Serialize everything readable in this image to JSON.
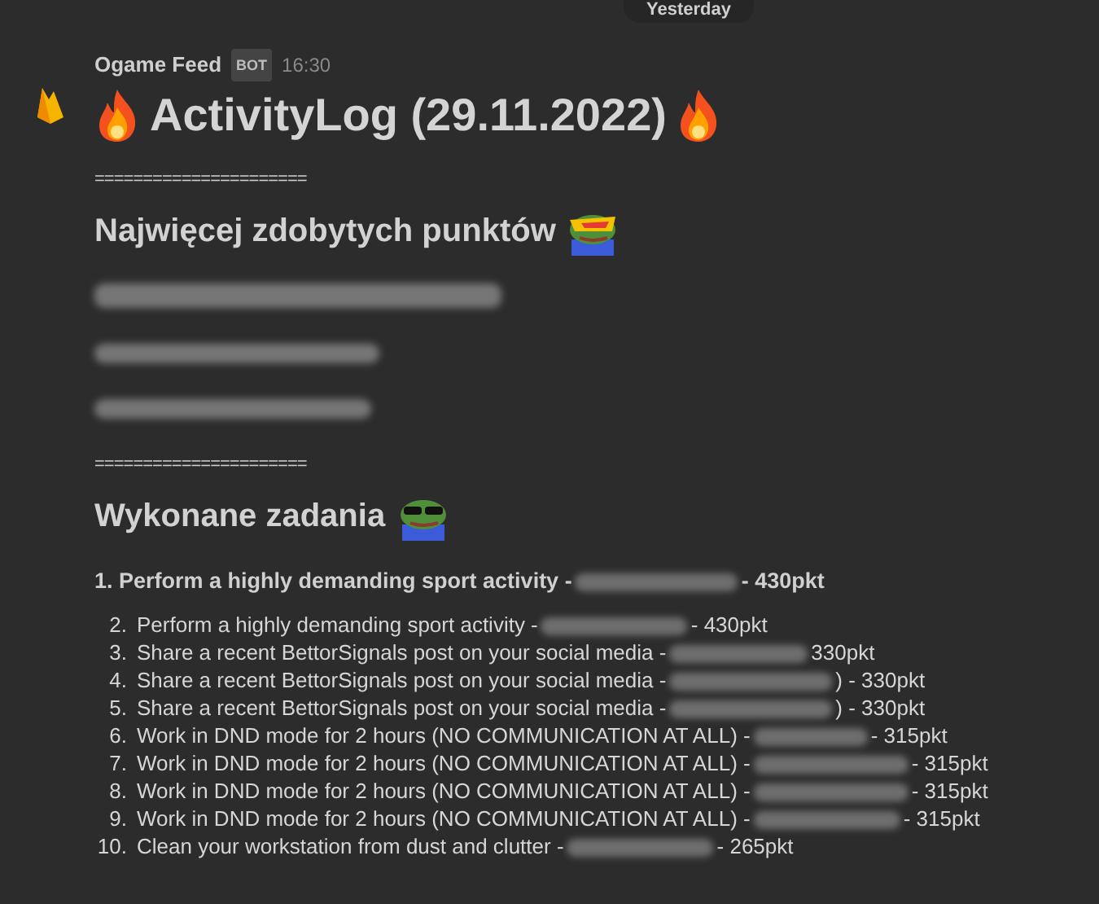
{
  "divider_label": "Yesterday",
  "message": {
    "author": "Ogame Feed",
    "badge": "BOT",
    "time": "16:30",
    "title": "ActivityLog (29.11.2022)",
    "rule_1": "======================",
    "heading_1": "Najwięcej zdobytych punktów",
    "top_list": [
      {
        "kind": "blurred"
      },
      {
        "kind": "blurred"
      },
      {
        "kind": "blurred"
      }
    ],
    "rule_2": "======================",
    "heading_2": "Wykonane zadania",
    "first_task": {
      "number": "1.",
      "task": "Perform a highly demanding sport activity -",
      "after": "- 430pkt"
    },
    "tasks": [
      {
        "number": "2.",
        "task": "Perform a highly demanding sport activity -",
        "after": "- 430pkt"
      },
      {
        "number": "3.",
        "task": "Share a recent BettorSignals post on your social media -",
        "after": "330pkt"
      },
      {
        "number": "4.",
        "task": "Share a recent BettorSignals post on your social media -",
        "after": ") - 330pkt"
      },
      {
        "number": "5.",
        "task": "Share a recent BettorSignals post on your social media -",
        "after": ") - 330pkt"
      },
      {
        "number": "6.",
        "task": "Work in DND mode for 2 hours (NO COMMUNICATION AT ALL) -",
        "after": "- 315pkt"
      },
      {
        "number": "7.",
        "task": "Work in DND mode for 2 hours (NO COMMUNICATION AT ALL) -",
        "after": "- 315pkt"
      },
      {
        "number": "8.",
        "task": "Work in DND mode for 2 hours (NO COMMUNICATION AT ALL) -",
        "after": "- 315pkt"
      },
      {
        "number": "9.",
        "task": "Work in DND mode for 2 hours (NO COMMUNICATION AT ALL) -",
        "after": "- 315pkt"
      },
      {
        "number": "10.",
        "task": "Clean your workstation from dust and clutter -",
        "after": "- 265pkt"
      }
    ]
  }
}
